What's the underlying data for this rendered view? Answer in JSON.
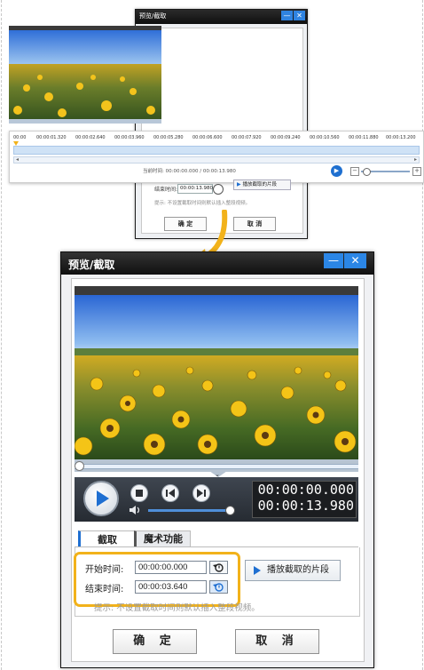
{
  "colors": {
    "accent": "#1f6fd1",
    "highlight": "#f2b21a",
    "titlebar": "#1a1a1a"
  },
  "small_dialog": {
    "title": "预览/截取",
    "minimize": "—",
    "close": "✕",
    "end_label": "结束时间:",
    "end_value": "00:00:13.980",
    "play_segment": "播放截取的片段",
    "tip": "提示: 不设置截取时间则默认插入整段视频。",
    "ok": "确 定",
    "cancel": "取 消"
  },
  "timeline": {
    "ticks": [
      "00:00",
      "00:00:01.320",
      "00:00:02.640",
      "00:00:03.960",
      "00:00:05.280",
      "00:00:06.600",
      "00:00:07.920",
      "00:00:09.240",
      "00:00:10.560",
      "00:00:11.880",
      "00:00:13.200"
    ],
    "current_time_text": "当前时间: 00:00:00.000 / 00:00:13.980"
  },
  "main_dialog": {
    "title": "预览/截取",
    "minimize": "—",
    "close": "✕",
    "timecode_current": "00:00:00.000",
    "timecode_total": "00:00:13.980",
    "volume_level": 0.95,
    "tabs": [
      "截取",
      "魔术功能"
    ],
    "start_label": "开始时间:",
    "start_value": "00:00:00.000",
    "end_label": "结束时间:",
    "end_value": "00:00:03.640",
    "play_segment": "播放截取的片段",
    "tip": "提示: 不设置截取时间则默认插入整段视频。",
    "ok": "确 定",
    "cancel": "取 消"
  },
  "icons": [
    "play-icon",
    "stop-icon",
    "prev-frame-icon",
    "next-frame-icon",
    "volume-icon",
    "reset-time-icon",
    "curved-arrow-icon"
  ]
}
